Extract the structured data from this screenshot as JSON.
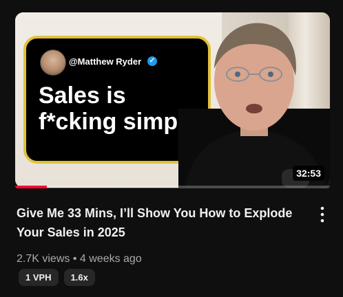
{
  "video": {
    "title": "Give Me 33 Mins, I’ll Show You How to Explode Your Sales in 2025",
    "duration": "32:53",
    "views": "2.7K views",
    "separator": "•",
    "age": "4 weeks ago",
    "watch_progress": 0.1,
    "badges": [
      "1 VPH",
      "1.6x"
    ]
  },
  "thumbnail": {
    "handle": "@Matthew Ryder",
    "quote": "Sales is f*cking simple",
    "verified_icon": "verified-check-icon",
    "accent_color": "#e2c13a"
  },
  "menu_icon": "more-vert-icon"
}
